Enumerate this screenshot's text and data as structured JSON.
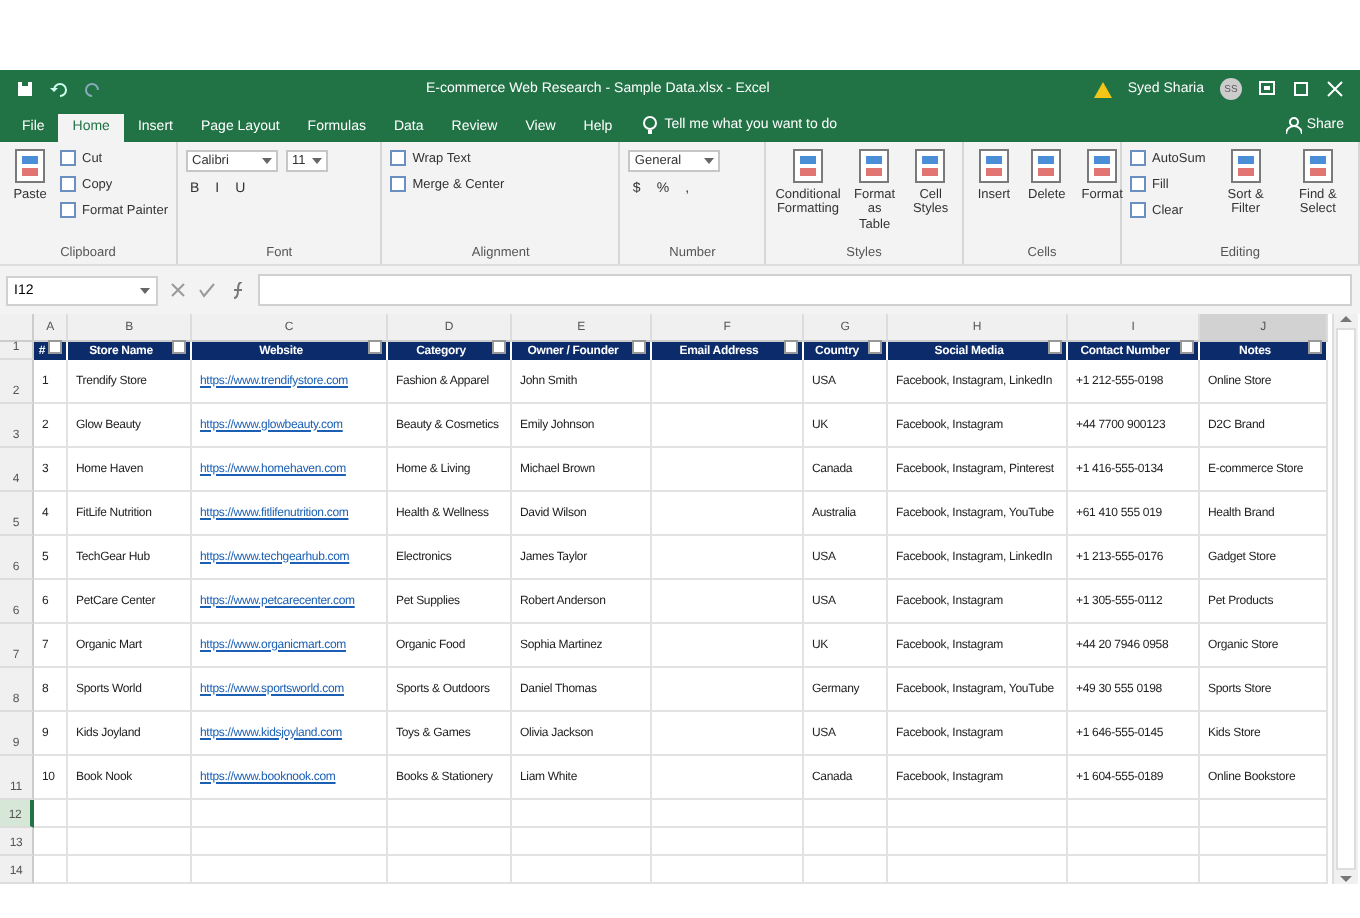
{
  "title_bar": {
    "title": "E-commerce Web Research - Sample Data.xlsx - Excel",
    "user": "Syed Sharia",
    "avatar": "SS"
  },
  "ribbon_tabs": [
    {
      "label": "File",
      "selected": false
    },
    {
      "label": "Home",
      "selected": true
    },
    {
      "label": "Insert",
      "selected": false
    },
    {
      "label": "Page Layout",
      "selected": false
    },
    {
      "label": "Formulas",
      "selected": false
    },
    {
      "label": "Data",
      "selected": false
    },
    {
      "label": "Review",
      "selected": false
    },
    {
      "label": "View",
      "selected": false
    },
    {
      "label": "Help",
      "selected": false
    }
  ],
  "tell_me": "Tell me what you want to do",
  "share": "Share",
  "ribbon_groups": [
    {
      "label": "Clipboard",
      "items": [
        {
          "kind": "large",
          "label": "Paste"
        },
        {
          "kind": "column",
          "items": [
            {
              "kind": "small",
              "label": "Cut"
            },
            {
              "kind": "small",
              "label": "Copy"
            },
            {
              "kind": "small",
              "label": "Format Painter"
            }
          ]
        }
      ]
    },
    {
      "label": "Font",
      "items": [
        {
          "kind": "column",
          "items": [
            {
              "kind": "combos",
              "values": [
                "Calibri",
                "11"
              ]
            },
            {
              "kind": "glyphs",
              "values": [
                "B",
                "I",
                "U"
              ]
            }
          ]
        }
      ]
    },
    {
      "label": "Alignment",
      "items": [
        {
          "kind": "column",
          "items": [
            {
              "kind": "small",
              "label": "Wrap Text"
            },
            {
              "kind": "small",
              "label": "Merge & Center"
            }
          ]
        }
      ]
    },
    {
      "label": "Number",
      "items": [
        {
          "kind": "column",
          "items": [
            {
              "kind": "combos",
              "values": [
                "General"
              ]
            },
            {
              "kind": "glyphs",
              "values": [
                "$",
                "%",
                ","
              ]
            }
          ]
        }
      ]
    },
    {
      "label": "Styles",
      "items": [
        {
          "kind": "large",
          "label": "Conditional Formatting"
        },
        {
          "kind": "large",
          "label": "Format as Table"
        },
        {
          "kind": "large",
          "label": "Cell Styles"
        }
      ]
    },
    {
      "label": "Cells",
      "items": [
        {
          "kind": "large",
          "label": "Insert"
        },
        {
          "kind": "large",
          "label": "Delete"
        },
        {
          "kind": "large",
          "label": "Format"
        }
      ]
    },
    {
      "label": "Editing",
      "items": [
        {
          "kind": "column",
          "items": [
            {
              "kind": "small",
              "label": "AutoSum"
            },
            {
              "kind": "small",
              "label": "Fill"
            },
            {
              "kind": "small",
              "label": "Clear"
            }
          ]
        },
        {
          "kind": "large",
          "label": "Sort & Filter"
        },
        {
          "kind": "large",
          "label": "Find & Select"
        }
      ]
    }
  ],
  "name_box": "I12",
  "columns": [
    {
      "letter": "A",
      "heading": "#",
      "kind": "text",
      "selected": false
    },
    {
      "letter": "B",
      "heading": "Store Name",
      "kind": "text",
      "selected": false
    },
    {
      "letter": "C",
      "heading": "Website",
      "kind": "link",
      "selected": false
    },
    {
      "letter": "D",
      "heading": "Category",
      "kind": "text",
      "selected": false
    },
    {
      "letter": "E",
      "heading": "Owner / Founder",
      "kind": "text",
      "selected": false
    },
    {
      "letter": "F",
      "heading": "Email Address",
      "kind": "text",
      "selected": false
    },
    {
      "letter": "G",
      "heading": "Country",
      "kind": "text",
      "selected": false
    },
    {
      "letter": "H",
      "heading": "Social Media",
      "kind": "text",
      "selected": false
    },
    {
      "letter": "I",
      "heading": "Contact Number",
      "kind": "text",
      "selected": false
    },
    {
      "letter": "J",
      "heading": "Notes",
      "kind": "text",
      "selected": true
    }
  ],
  "header_row": "1",
  "rows": [
    {
      "row_number": "2",
      "selected": false,
      "cells": {
        "A": "1",
        "B": "Trendify Store",
        "C": "https://www.trendifystore.com",
        "D": "Fashion & Apparel",
        "E": "John Smith",
        "G": "USA",
        "H": "Facebook, Instagram, LinkedIn",
        "I": "+1 212-555-0198",
        "J": "Online Store"
      }
    },
    {
      "row_number": "3",
      "selected": false,
      "cells": {
        "A": "2",
        "B": "Glow Beauty",
        "C": "https://www.glowbeauty.com",
        "D": "Beauty & Cosmetics",
        "E": "Emily Johnson",
        "G": "UK",
        "H": "Facebook, Instagram",
        "I": "+44 7700 900123",
        "J": "D2C Brand"
      }
    },
    {
      "row_number": "4",
      "selected": false,
      "cells": {
        "A": "3",
        "B": "Home Haven",
        "C": "https://www.homehaven.com",
        "D": "Home & Living",
        "E": "Michael Brown",
        "G": "Canada",
        "H": "Facebook, Instagram, Pinterest",
        "I": "+1 416-555-0134",
        "J": "E-commerce Store"
      }
    },
    {
      "row_number": "5",
      "selected": false,
      "cells": {
        "A": "4",
        "B": "FitLife Nutrition",
        "C": "https://www.fitlifenutrition.com",
        "D": "Health & Wellness",
        "E": "David Wilson",
        "G": "Australia",
        "H": "Facebook, Instagram, YouTube",
        "I": "+61 410 555 019",
        "J": "Health Brand"
      }
    },
    {
      "row_number": "6",
      "selected": false,
      "cells": {
        "A": "5",
        "B": "TechGear Hub",
        "C": "https://www.techgearhub.com",
        "D": "Electronics",
        "E": "James Taylor",
        "G": "USA",
        "H": "Facebook, Instagram, LinkedIn",
        "I": "+1 213-555-0176",
        "J": "Gadget Store"
      }
    },
    {
      "row_number": "6",
      "selected": false,
      "cells": {
        "A": "6",
        "B": "PetCare Center",
        "C": "https://www.petcarecenter.com",
        "D": "Pet Supplies",
        "E": "Robert Anderson",
        "G": "USA",
        "H": "Facebook, Instagram",
        "I": "+1 305-555-0112",
        "J": "Pet Products"
      }
    },
    {
      "row_number": "7",
      "selected": false,
      "cells": {
        "A": "7",
        "B": "Organic Mart",
        "C": "https://www.organicmart.com",
        "D": "Organic Food",
        "E": "Sophia Martinez",
        "G": "UK",
        "H": "Facebook, Instagram",
        "I": "+44 20 7946 0958",
        "J": "Organic Store"
      }
    },
    {
      "row_number": "8",
      "selected": false,
      "cells": {
        "A": "8",
        "B": "Sports World",
        "C": "https://www.sportsworld.com",
        "D": "Sports & Outdoors",
        "E": "Daniel Thomas",
        "G": "Germany",
        "H": "Facebook, Instagram, YouTube",
        "I": "+49 30 555 0198",
        "J": "Sports Store"
      }
    },
    {
      "row_number": "9",
      "selected": false,
      "cells": {
        "A": "9",
        "B": "Kids Joyland",
        "C": "https://www.kidsjoyland.com",
        "D": "Toys & Games",
        "E": "Olivia Jackson",
        "G": "USA",
        "H": "Facebook, Instagram",
        "I": "+1 646-555-0145",
        "J": "Kids Store"
      }
    },
    {
      "row_number": "11",
      "selected": false,
      "cells": {
        "A": "10",
        "B": "Book Nook",
        "C": "https://www.booknook.com",
        "D": "Books & Stationery",
        "E": "Liam White",
        "G": "Canada",
        "H": "Facebook, Instagram",
        "I": "+1 604-555-0189",
        "J": "Online Bookstore"
      }
    },
    {
      "row_number": "12",
      "selected": true,
      "cells": {}
    },
    {
      "row_number": "13",
      "selected": false,
      "cells": {}
    },
    {
      "row_number": "14",
      "selected": false,
      "cells": {}
    }
  ]
}
